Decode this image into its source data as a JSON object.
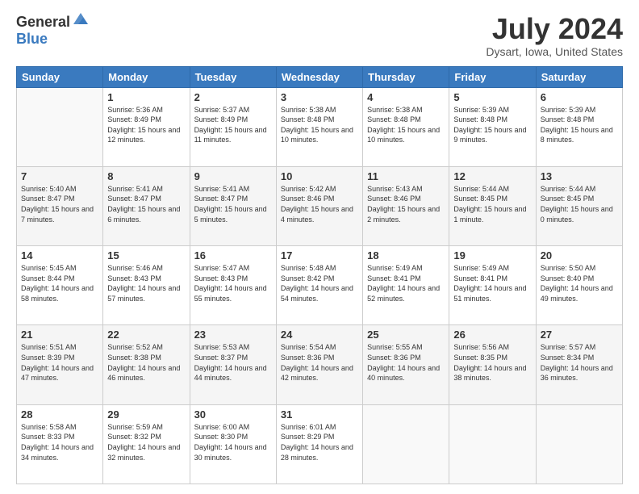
{
  "logo": {
    "general": "General",
    "blue": "Blue"
  },
  "title": "July 2024",
  "subtitle": "Dysart, Iowa, United States",
  "weekdays": [
    "Sunday",
    "Monday",
    "Tuesday",
    "Wednesday",
    "Thursday",
    "Friday",
    "Saturday"
  ],
  "weeks": [
    [
      {
        "day": "",
        "sunrise": "",
        "sunset": "",
        "daylight": ""
      },
      {
        "day": "1",
        "sunrise": "Sunrise: 5:36 AM",
        "sunset": "Sunset: 8:49 PM",
        "daylight": "Daylight: 15 hours and 12 minutes."
      },
      {
        "day": "2",
        "sunrise": "Sunrise: 5:37 AM",
        "sunset": "Sunset: 8:49 PM",
        "daylight": "Daylight: 15 hours and 11 minutes."
      },
      {
        "day": "3",
        "sunrise": "Sunrise: 5:38 AM",
        "sunset": "Sunset: 8:48 PM",
        "daylight": "Daylight: 15 hours and 10 minutes."
      },
      {
        "day": "4",
        "sunrise": "Sunrise: 5:38 AM",
        "sunset": "Sunset: 8:48 PM",
        "daylight": "Daylight: 15 hours and 10 minutes."
      },
      {
        "day": "5",
        "sunrise": "Sunrise: 5:39 AM",
        "sunset": "Sunset: 8:48 PM",
        "daylight": "Daylight: 15 hours and 9 minutes."
      },
      {
        "day": "6",
        "sunrise": "Sunrise: 5:39 AM",
        "sunset": "Sunset: 8:48 PM",
        "daylight": "Daylight: 15 hours and 8 minutes."
      }
    ],
    [
      {
        "day": "7",
        "sunrise": "Sunrise: 5:40 AM",
        "sunset": "Sunset: 8:47 PM",
        "daylight": "Daylight: 15 hours and 7 minutes."
      },
      {
        "day": "8",
        "sunrise": "Sunrise: 5:41 AM",
        "sunset": "Sunset: 8:47 PM",
        "daylight": "Daylight: 15 hours and 6 minutes."
      },
      {
        "day": "9",
        "sunrise": "Sunrise: 5:41 AM",
        "sunset": "Sunset: 8:47 PM",
        "daylight": "Daylight: 15 hours and 5 minutes."
      },
      {
        "day": "10",
        "sunrise": "Sunrise: 5:42 AM",
        "sunset": "Sunset: 8:46 PM",
        "daylight": "Daylight: 15 hours and 4 minutes."
      },
      {
        "day": "11",
        "sunrise": "Sunrise: 5:43 AM",
        "sunset": "Sunset: 8:46 PM",
        "daylight": "Daylight: 15 hours and 2 minutes."
      },
      {
        "day": "12",
        "sunrise": "Sunrise: 5:44 AM",
        "sunset": "Sunset: 8:45 PM",
        "daylight": "Daylight: 15 hours and 1 minute."
      },
      {
        "day": "13",
        "sunrise": "Sunrise: 5:44 AM",
        "sunset": "Sunset: 8:45 PM",
        "daylight": "Daylight: 15 hours and 0 minutes."
      }
    ],
    [
      {
        "day": "14",
        "sunrise": "Sunrise: 5:45 AM",
        "sunset": "Sunset: 8:44 PM",
        "daylight": "Daylight: 14 hours and 58 minutes."
      },
      {
        "day": "15",
        "sunrise": "Sunrise: 5:46 AM",
        "sunset": "Sunset: 8:43 PM",
        "daylight": "Daylight: 14 hours and 57 minutes."
      },
      {
        "day": "16",
        "sunrise": "Sunrise: 5:47 AM",
        "sunset": "Sunset: 8:43 PM",
        "daylight": "Daylight: 14 hours and 55 minutes."
      },
      {
        "day": "17",
        "sunrise": "Sunrise: 5:48 AM",
        "sunset": "Sunset: 8:42 PM",
        "daylight": "Daylight: 14 hours and 54 minutes."
      },
      {
        "day": "18",
        "sunrise": "Sunrise: 5:49 AM",
        "sunset": "Sunset: 8:41 PM",
        "daylight": "Daylight: 14 hours and 52 minutes."
      },
      {
        "day": "19",
        "sunrise": "Sunrise: 5:49 AM",
        "sunset": "Sunset: 8:41 PM",
        "daylight": "Daylight: 14 hours and 51 minutes."
      },
      {
        "day": "20",
        "sunrise": "Sunrise: 5:50 AM",
        "sunset": "Sunset: 8:40 PM",
        "daylight": "Daylight: 14 hours and 49 minutes."
      }
    ],
    [
      {
        "day": "21",
        "sunrise": "Sunrise: 5:51 AM",
        "sunset": "Sunset: 8:39 PM",
        "daylight": "Daylight: 14 hours and 47 minutes."
      },
      {
        "day": "22",
        "sunrise": "Sunrise: 5:52 AM",
        "sunset": "Sunset: 8:38 PM",
        "daylight": "Daylight: 14 hours and 46 minutes."
      },
      {
        "day": "23",
        "sunrise": "Sunrise: 5:53 AM",
        "sunset": "Sunset: 8:37 PM",
        "daylight": "Daylight: 14 hours and 44 minutes."
      },
      {
        "day": "24",
        "sunrise": "Sunrise: 5:54 AM",
        "sunset": "Sunset: 8:36 PM",
        "daylight": "Daylight: 14 hours and 42 minutes."
      },
      {
        "day": "25",
        "sunrise": "Sunrise: 5:55 AM",
        "sunset": "Sunset: 8:36 PM",
        "daylight": "Daylight: 14 hours and 40 minutes."
      },
      {
        "day": "26",
        "sunrise": "Sunrise: 5:56 AM",
        "sunset": "Sunset: 8:35 PM",
        "daylight": "Daylight: 14 hours and 38 minutes."
      },
      {
        "day": "27",
        "sunrise": "Sunrise: 5:57 AM",
        "sunset": "Sunset: 8:34 PM",
        "daylight": "Daylight: 14 hours and 36 minutes."
      }
    ],
    [
      {
        "day": "28",
        "sunrise": "Sunrise: 5:58 AM",
        "sunset": "Sunset: 8:33 PM",
        "daylight": "Daylight: 14 hours and 34 minutes."
      },
      {
        "day": "29",
        "sunrise": "Sunrise: 5:59 AM",
        "sunset": "Sunset: 8:32 PM",
        "daylight": "Daylight: 14 hours and 32 minutes."
      },
      {
        "day": "30",
        "sunrise": "Sunrise: 6:00 AM",
        "sunset": "Sunset: 8:30 PM",
        "daylight": "Daylight: 14 hours and 30 minutes."
      },
      {
        "day": "31",
        "sunrise": "Sunrise: 6:01 AM",
        "sunset": "Sunset: 8:29 PM",
        "daylight": "Daylight: 14 hours and 28 minutes."
      },
      {
        "day": "",
        "sunrise": "",
        "sunset": "",
        "daylight": ""
      },
      {
        "day": "",
        "sunrise": "",
        "sunset": "",
        "daylight": ""
      },
      {
        "day": "",
        "sunrise": "",
        "sunset": "",
        "daylight": ""
      }
    ]
  ]
}
